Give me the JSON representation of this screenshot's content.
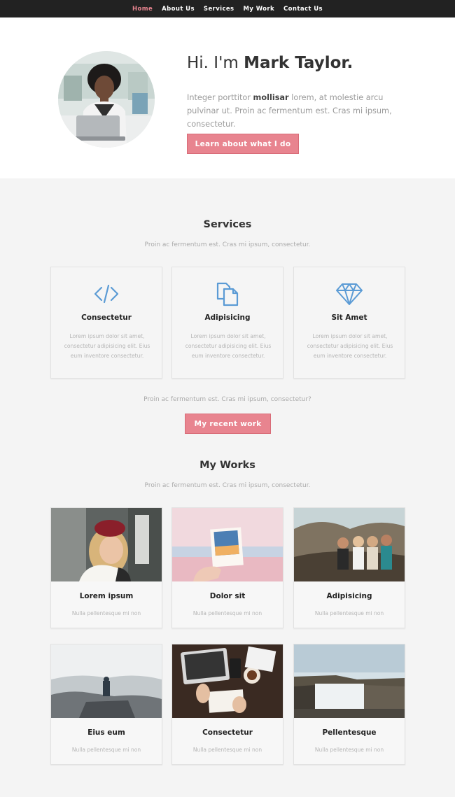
{
  "nav": {
    "items": [
      {
        "label": "Home",
        "active": true
      },
      {
        "label": "About Us",
        "active": false
      },
      {
        "label": "Services",
        "active": false
      },
      {
        "label": "My Work",
        "active": false
      },
      {
        "label": "Contact Us",
        "active": false
      }
    ]
  },
  "hero": {
    "greeting": "Hi. I'm",
    "name": "Mark Taylor.",
    "text_before": "Integer porttitor",
    "text_bold": "mollisar",
    "text_after": "lorem, at molestie arcu pulvinar ut. Proin ac fermentum est. Cras mi ipsum, consectetur.",
    "button": "Learn about what I do"
  },
  "services": {
    "title": "Services",
    "subtitle": "Proin ac fermentum est. Cras mi ipsum, consectetur.",
    "items": [
      {
        "icon": "code-icon",
        "title": "Consectetur",
        "text": "Lorem ipsum dolor sit amet, consectetur adipisicing elit. Eius eum inventore consectetur."
      },
      {
        "icon": "documents-icon",
        "title": "Adipisicing",
        "text": "Lorem ipsum dolor sit amet, consectetur adipisicing elit. Eius eum inventore consectetur."
      },
      {
        "icon": "diamond-icon",
        "title": "Sit Amet",
        "text": "Lorem ipsum dolor sit amet, consectetur adipisicing elit. Eius eum inventore consectetur."
      }
    ],
    "question": "Proin ac fermentum est. Cras mi ipsum, consectetur?",
    "button": "My recent work"
  },
  "works": {
    "title": "My Works",
    "subtitle": "Proin ac fermentum est. Cras mi ipsum, consectetur.",
    "items": [
      {
        "title": "Lorem ipsum",
        "sub": "Nulla pellentesque mi non"
      },
      {
        "title": "Dolor sit",
        "sub": "Nulla pellentesque mi non"
      },
      {
        "title": "Adipisicing",
        "sub": "Nulla pellentesque mi non"
      },
      {
        "title": "Eius eum",
        "sub": "Nulla pellentesque mi non"
      },
      {
        "title": "Consectetur",
        "sub": "Nulla pellentesque mi non"
      },
      {
        "title": "Pellentesque",
        "sub": "Nulla pellentesque mi non"
      }
    ]
  },
  "colors": {
    "accent": "#e8848f",
    "nav_bg": "#222222",
    "icon_blue": "#5b9bd5"
  }
}
